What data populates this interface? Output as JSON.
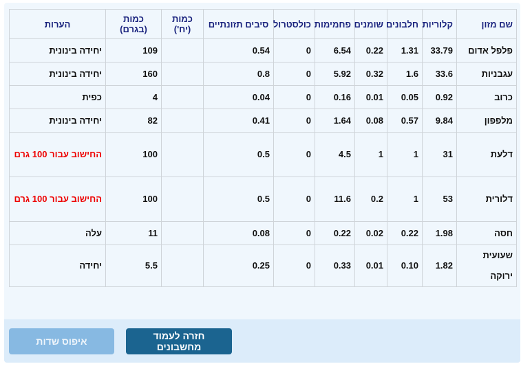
{
  "headers": [
    "שם מזון",
    "קלוריות",
    "חלבונים",
    "שומנים",
    "פחמימות",
    "כולסטרול",
    "סיבים תזונתיים",
    "כמות (יח')",
    "כמות (בגרם)",
    "הערות"
  ],
  "rows": [
    {
      "name": "פלפל אדום",
      "cal": "33.79",
      "protein": "1.31",
      "fat": "0.22",
      "carbs": "6.54",
      "chol": "0",
      "fiber": "0.54",
      "units": "",
      "grams": "109",
      "note": "יחידה בינונית"
    },
    {
      "name": "עגבניות",
      "cal": "33.6",
      "protein": "1.6",
      "fat": "0.32",
      "carbs": "5.92",
      "chol": "0",
      "fiber": "0.8",
      "units": "",
      "grams": "160",
      "note": "יחידה בינונית"
    },
    {
      "name": "כרוב",
      "cal": "0.92",
      "protein": "0.05",
      "fat": "0.01",
      "carbs": "0.16",
      "chol": "0",
      "fiber": "0.04",
      "units": "",
      "grams": "4",
      "note": "כפית"
    },
    {
      "name": "מלפפון",
      "cal": "9.84",
      "protein": "0.57",
      "fat": "0.08",
      "carbs": "1.64",
      "chol": "0",
      "fiber": "0.41",
      "units": "",
      "grams": "82",
      "note": "יחידה בינונית"
    },
    {
      "name": "דלעת",
      "cal": "31",
      "protein": "1",
      "fat": "1",
      "carbs": "4.5",
      "chol": "0",
      "fiber": "0.5",
      "units": "",
      "grams": "100",
      "note": "החישוב עבור 100 גרם"
    },
    {
      "name": "דלורית",
      "cal": "53",
      "protein": "1",
      "fat": "0.2",
      "carbs": "11.6",
      "chol": "0",
      "fiber": "0.5",
      "units": "",
      "grams": "100",
      "note": "החישוב עבור 100 גרם"
    },
    {
      "name": "חסה",
      "cal": "1.98",
      "protein": "0.22",
      "fat": "0.02",
      "carbs": "0.22",
      "chol": "0",
      "fiber": "0.08",
      "units": "",
      "grams": "11",
      "note": "עלה"
    },
    {
      "name": "שעועית ירוקה",
      "cal": "1.82",
      "protein": "0.10",
      "fat": "0.01",
      "carbs": "0.33",
      "chol": "0",
      "fiber": "0.25",
      "units": "",
      "grams": "5.5",
      "note": "יחידה"
    }
  ],
  "buttons": {
    "back": "חזרה לעמוד מחשבונים",
    "reset": "איפוס שדות"
  }
}
